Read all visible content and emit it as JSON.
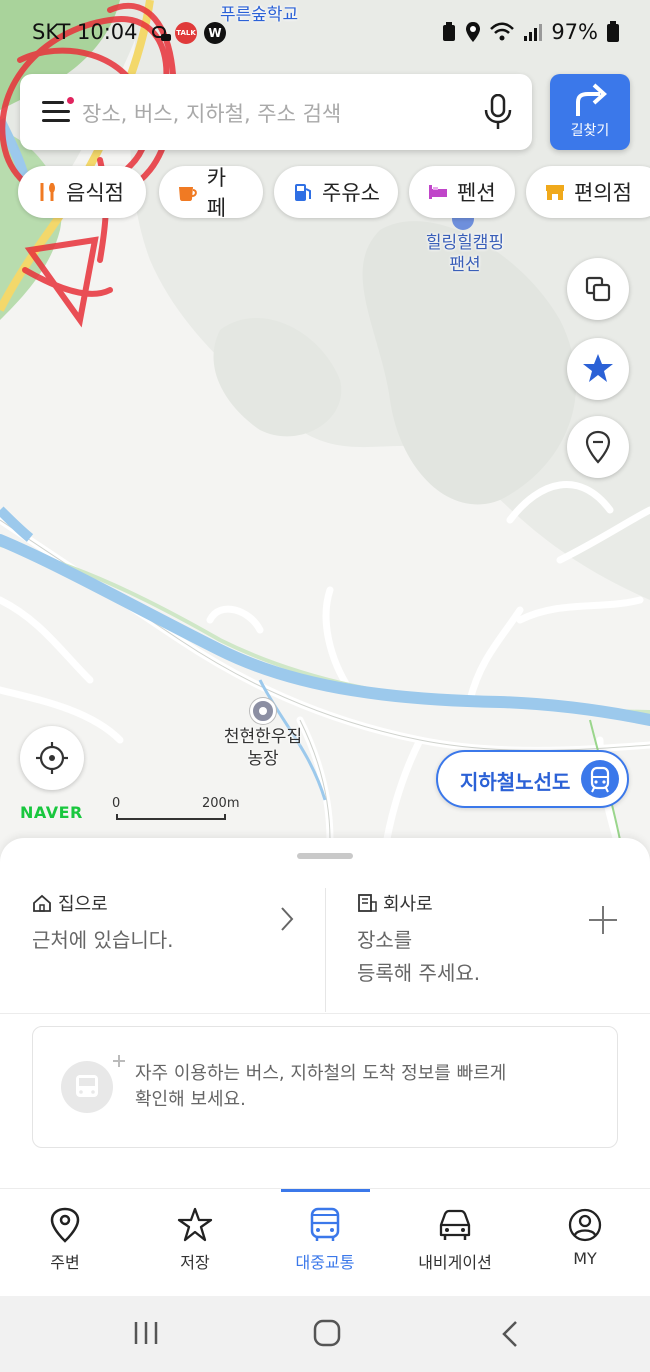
{
  "status_bar": {
    "time": "SKT 10:04",
    "battery": "97%"
  },
  "search": {
    "placeholder": "장소, 버스, 지하철, 주소 검색"
  },
  "route_button": {
    "label": "길찾기"
  },
  "chips": [
    {
      "label": "음식점",
      "icon": "fork-spoon-icon",
      "color": "#f07a23"
    },
    {
      "label": "카페",
      "icon": "coffee-cup-icon",
      "color": "#f07a23"
    },
    {
      "label": "주유소",
      "icon": "gas-pump-icon",
      "color": "#2f6fe4"
    },
    {
      "label": "펜션",
      "icon": "bed-icon",
      "color": "#c045c9"
    },
    {
      "label": "편의점",
      "icon": "store-icon",
      "color": "#f0a91b"
    }
  ],
  "map": {
    "labels": {
      "school": "푸른숲학교",
      "pension_line1": "힐링힐캠핑",
      "pension_line2": "팬션",
      "farm_line1": "천현한우집",
      "farm_line2": "농장"
    },
    "scale": {
      "zero": "0",
      "distance": "200m"
    },
    "naver_logo": "NAVER",
    "subway_map_label": "지하철노선도"
  },
  "favorites": {
    "home": {
      "title": "집으로",
      "desc": "근처에 있습니다."
    },
    "work": {
      "title": "회사로",
      "desc_line1": "장소를",
      "desc_line2": "등록해 주세요."
    }
  },
  "transit_info": {
    "line1": "자주 이용하는 버스, 지하철의 도착 정보를 빠르게",
    "line2": "확인해 보세요."
  },
  "tabs": [
    {
      "label": "주변",
      "icon": "location-pin-icon",
      "active": false
    },
    {
      "label": "저장",
      "icon": "star-outline-icon",
      "active": false
    },
    {
      "label": "대중교통",
      "icon": "bus-icon",
      "active": true
    },
    {
      "label": "내비게이션",
      "icon": "car-icon",
      "active": false
    },
    {
      "label": "MY",
      "icon": "user-icon",
      "active": false
    }
  ],
  "colors": {
    "accent": "#3b78ea",
    "river": "#9cc9ec",
    "naver_green": "#19c73e",
    "annotation": "#e8323a"
  }
}
